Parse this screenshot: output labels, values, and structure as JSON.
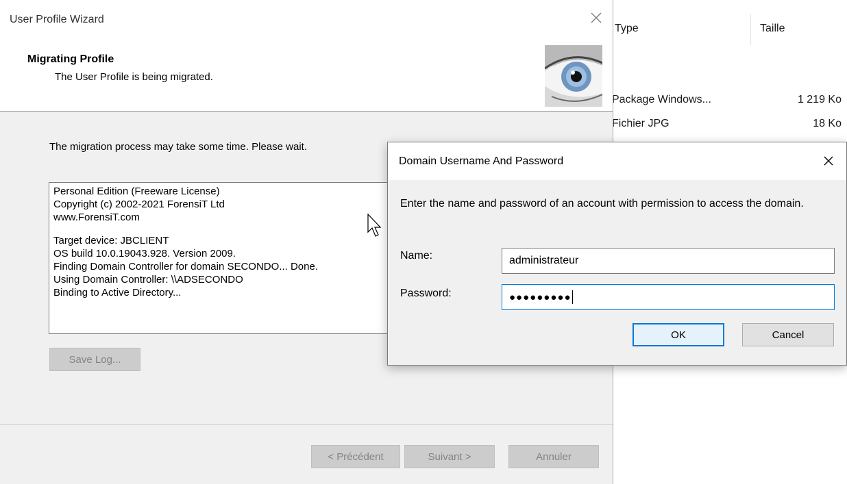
{
  "explorer": {
    "columns": [
      "Type",
      "Taille"
    ],
    "rows": [
      {
        "type": "Package Windows...",
        "size": "1 219 Ko"
      },
      {
        "type": "Fichier JPG",
        "size": "18 Ko"
      }
    ]
  },
  "wizard": {
    "title": "User Profile Wizard",
    "heading": "Migrating Profile",
    "subheading": "The User Profile is being migrated.",
    "message": "The migration process may take some time. Please wait.",
    "log_lines": [
      "Personal Edition (Freeware License)",
      "Copyright (c) 2002-2021 ForensiT Ltd",
      "www.ForensiT.com",
      "",
      "Target device: JBCLIENT",
      "OS build 10.0.19043.928. Version 2009.",
      "Finding Domain Controller for domain SECONDO... Done.",
      "Using Domain Controller: \\\\ADSECONDO",
      "Binding to Active Directory..."
    ],
    "save_log_label": "Save Log...",
    "back_label": "< Précédent",
    "next_label": "Suivant >",
    "cancel_label": "Annuler"
  },
  "dialog": {
    "title": "Domain Username And Password",
    "description": "Enter the name and password of an account with permission to access the domain.",
    "name_label": "Name:",
    "name_value": "administrateur",
    "password_label": "Password:",
    "password_value": "●●●●●●●●●",
    "ok_label": "OK",
    "cancel_label": "Cancel"
  }
}
